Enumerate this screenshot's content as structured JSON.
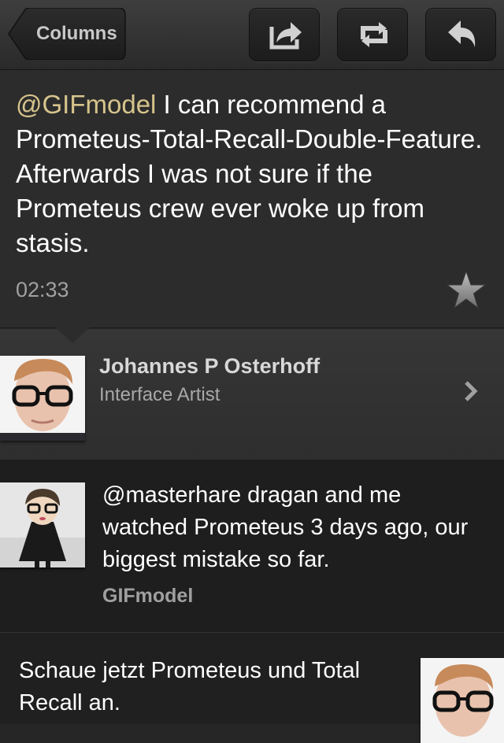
{
  "toolbar": {
    "back_label": "Columns",
    "buttons": [
      {
        "icon": "share-icon"
      },
      {
        "icon": "retweet-icon"
      },
      {
        "icon": "reply-icon"
      }
    ]
  },
  "tweet": {
    "mention": "@GIFmodel",
    "text": " I can recommend a Prometeus-Total-Recall-Double-Feature. Afterwards I was not sure if the Prometeus crew ever woke up from stasis.",
    "time": "02:33",
    "favorite_icon": "star-icon"
  },
  "author": {
    "name": "Johannes P Osterhoff",
    "bio": "Interface Artist"
  },
  "timeline": [
    {
      "text": "@masterhare  dragan and me watched Prometeus 3 days ago, our biggest mistake so far.",
      "user": "GIFmodel"
    },
    {
      "text": "Schaue jetzt Prometeus und Total Recall an."
    }
  ],
  "colors": {
    "mention": "#d6c48c",
    "background": "#262626"
  }
}
